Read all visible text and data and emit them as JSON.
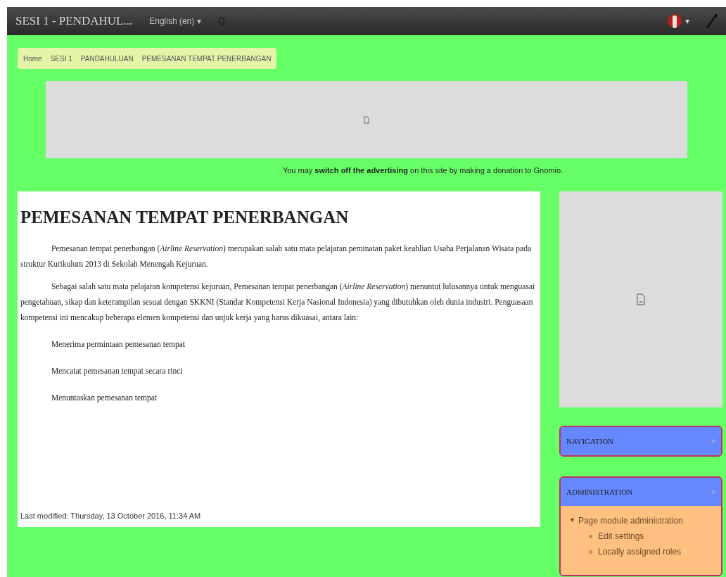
{
  "navbar": {
    "title": "SESI 1 - PENDAHUL...",
    "language": "English (en) ▾",
    "user_menu_caret": "▾"
  },
  "breadcrumb": [
    "Home",
    "SESI 1",
    "PANDAHULUAN",
    "PEMESANAN TEMPAT PENERBANGAN"
  ],
  "ad_notice": "You may **switch off the advertising** on this site by making a donation to Gnomio.",
  "article": {
    "title": "PEMESANAN TEMPAT PENERBANGAN",
    "paragraphs": [
      "Pemesanan tempat penerbangan (*Airline Reservation*) merupakan salah satu mata pelajaran peminatan paket keahlian Usaha Perjalanan Wisata pada struktur Kurikulum 2013 di Sekolah Menengah Kejuruan.",
      "Sebagai salah satu mata pelajaran kompetensi kejuruan, Pemesanan tempat penerbangan (*Airline Reservation*) menuntut lulusannya untuk menguasai pengetahuan, sikap dan keterampilan sesuai dengan SKKNI (Standar Kompetensi Kerja Nasional Indonesia) yang dibutuhkan oleh dunia industri. Penguasaan kompetensi ini mencakup beberapa elemen kompetensi dan unjuk kerja yang harus dikuasai, antara lain:"
    ],
    "items": [
      "Menerima permintaan pemesanan tempat",
      "Mencatat pemesanan tempat secara rinci",
      "Menuntaskan pemesanan tempat"
    ],
    "last_modified": "Last modified: Thursday, 13 October 2016, 11:34 AM"
  },
  "blocks": [
    {
      "title": "NAVIGATION"
    },
    {
      "title": "ADMINISTRATION",
      "children": [
        {
          "label": "Page module administration",
          "caret": "▼",
          "children": [
            {
              "label": "Edit settings"
            },
            {
              "label": "Locally assigned roles"
            }
          ]
        }
      ]
    }
  ]
}
